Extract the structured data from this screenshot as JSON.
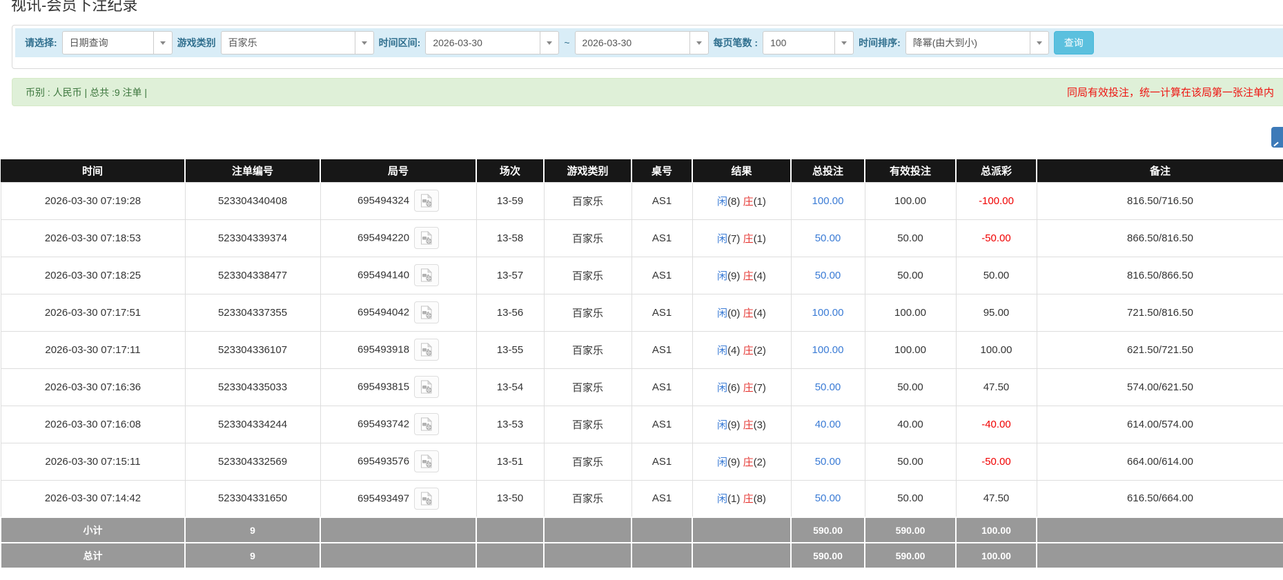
{
  "page": {
    "title": "视讯-会员下注纪录"
  },
  "colors": {
    "filter_bg": "#d9edf7",
    "summary_bg": "#dff0d8",
    "summary_text": "#3c763d",
    "notice_red": "#ee1411",
    "header_bg": "#171717",
    "footer_bg": "#999999",
    "link_blue": "#3a7bd5",
    "banker_red": "#e53935",
    "search_btn": "#5bc0de"
  },
  "icons": {
    "dropdown": "caret-down",
    "video_replay": "video-file",
    "corner_button": "arrow-fragment"
  },
  "filters": {
    "select_label": "请选择:",
    "select_value": "日期查询",
    "game_type_label": "游戏类别",
    "game_type_value": "百家乐",
    "time_range_label": "时间区间:",
    "date_from": "2026-03-30",
    "date_separator": "~",
    "date_to": "2026-03-30",
    "page_size_label": "每页笔数 :",
    "page_size_value": "100",
    "sort_label": "时间排序:",
    "sort_value": "降幂(由大到小)",
    "search_button": "查询"
  },
  "summary": {
    "currency_info": "币别 : 人民币 | 总共 :9 注单 |",
    "notice": "同局有效投注，统一计算在该局第一张注单内"
  },
  "table": {
    "headers": [
      "时间",
      "注单编号",
      "局号",
      "场次",
      "游戏类别",
      "桌号",
      "结果",
      "总投注",
      "有效投注",
      "总派彩",
      "备注"
    ],
    "rows": [
      {
        "time": "2026-03-30 07:19:28",
        "bet_id": "523304340408",
        "round_id": "695494324",
        "session": "13-59",
        "game": "百家乐",
        "table_no": "AS1",
        "player": "闲",
        "player_pts": "(8)",
        "banker": "庄",
        "banker_pts": "(1)",
        "total_bet": "100.00",
        "valid_bet": "100.00",
        "payout": "-100.00",
        "remark": "816.50/716.50"
      },
      {
        "time": "2026-03-30 07:18:53",
        "bet_id": "523304339374",
        "round_id": "695494220",
        "session": "13-58",
        "game": "百家乐",
        "table_no": "AS1",
        "player": "闲",
        "player_pts": "(7)",
        "banker": "庄",
        "banker_pts": "(1)",
        "total_bet": "50.00",
        "valid_bet": "50.00",
        "payout": "-50.00",
        "remark": "866.50/816.50"
      },
      {
        "time": "2026-03-30 07:18:25",
        "bet_id": "523304338477",
        "round_id": "695494140",
        "session": "13-57",
        "game": "百家乐",
        "table_no": "AS1",
        "player": "闲",
        "player_pts": "(9)",
        "banker": "庄",
        "banker_pts": "(4)",
        "total_bet": "50.00",
        "valid_bet": "50.00",
        "payout": "50.00",
        "remark": "816.50/866.50"
      },
      {
        "time": "2026-03-30 07:17:51",
        "bet_id": "523304337355",
        "round_id": "695494042",
        "session": "13-56",
        "game": "百家乐",
        "table_no": "AS1",
        "player": "闲",
        "player_pts": "(0)",
        "banker": "庄",
        "banker_pts": "(4)",
        "total_bet": "100.00",
        "valid_bet": "100.00",
        "payout": "95.00",
        "remark": "721.50/816.50"
      },
      {
        "time": "2026-03-30 07:17:11",
        "bet_id": "523304336107",
        "round_id": "695493918",
        "session": "13-55",
        "game": "百家乐",
        "table_no": "AS1",
        "player": "闲",
        "player_pts": "(4)",
        "banker": "庄",
        "banker_pts": "(2)",
        "total_bet": "100.00",
        "valid_bet": "100.00",
        "payout": "100.00",
        "remark": "621.50/721.50"
      },
      {
        "time": "2026-03-30 07:16:36",
        "bet_id": "523304335033",
        "round_id": "695493815",
        "session": "13-54",
        "game": "百家乐",
        "table_no": "AS1",
        "player": "闲",
        "player_pts": "(6)",
        "banker": "庄",
        "banker_pts": "(7)",
        "total_bet": "50.00",
        "valid_bet": "50.00",
        "payout": "47.50",
        "remark": "574.00/621.50"
      },
      {
        "time": "2026-03-30 07:16:08",
        "bet_id": "523304334244",
        "round_id": "695493742",
        "session": "13-53",
        "game": "百家乐",
        "table_no": "AS1",
        "player": "闲",
        "player_pts": "(9)",
        "banker": "庄",
        "banker_pts": "(3)",
        "total_bet": "40.00",
        "valid_bet": "40.00",
        "payout": "-40.00",
        "remark": "614.00/574.00"
      },
      {
        "time": "2026-03-30 07:15:11",
        "bet_id": "523304332569",
        "round_id": "695493576",
        "session": "13-51",
        "game": "百家乐",
        "table_no": "AS1",
        "player": "闲",
        "player_pts": "(9)",
        "banker": "庄",
        "banker_pts": "(2)",
        "total_bet": "50.00",
        "valid_bet": "50.00",
        "payout": "-50.00",
        "remark": "664.00/614.00"
      },
      {
        "time": "2026-03-30 07:14:42",
        "bet_id": "523304331650",
        "round_id": "695493497",
        "session": "13-50",
        "game": "百家乐",
        "table_no": "AS1",
        "player": "闲",
        "player_pts": "(1)",
        "banker": "庄",
        "banker_pts": "(8)",
        "total_bet": "50.00",
        "valid_bet": "50.00",
        "payout": "47.50",
        "remark": "616.50/664.00"
      }
    ],
    "subtotal": {
      "label": "小计",
      "count": "9",
      "total_bet": "590.00",
      "valid_bet": "590.00",
      "payout": "100.00"
    },
    "total": {
      "label": "总计",
      "count": "9",
      "total_bet": "590.00",
      "valid_bet": "590.00",
      "payout": "100.00"
    }
  }
}
